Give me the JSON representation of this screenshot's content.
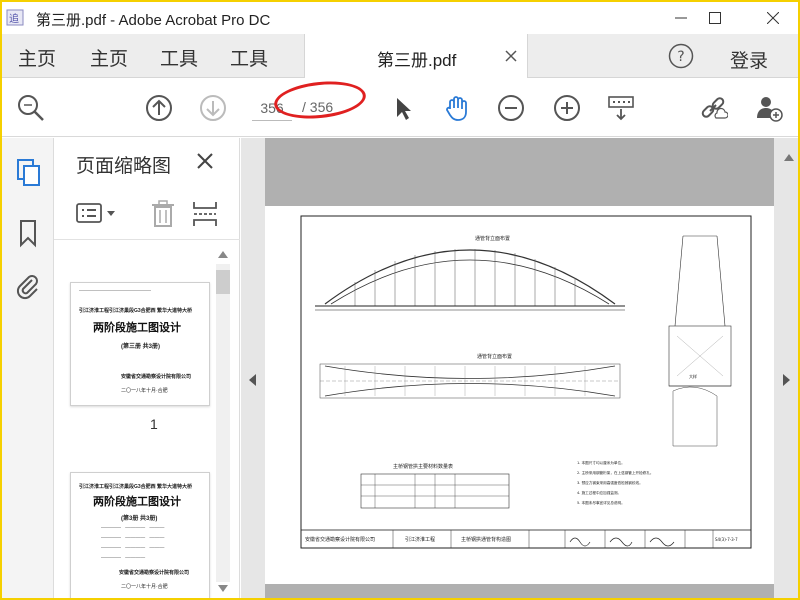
{
  "window": {
    "title": "第三册.pdf - Adobe Acrobat Pro DC"
  },
  "tabs": {
    "nav": [
      "主页",
      "主页",
      "工具",
      "工具"
    ],
    "document_tab": "第三册.pdf",
    "login_label": "登录"
  },
  "toolbar": {
    "current_page": "356",
    "total_pages": "/ 356"
  },
  "thumbnails_panel": {
    "title": "页面缩略图",
    "pages": [
      {
        "number": "1",
        "project": "引江济淮工程引江济巢段G3合肥西 繁华大道特大桥",
        "design_title": "两阶段施工图设计",
        "volume": "(第三册 共3册)",
        "company": "安徽省交通勘察设计院有限公司",
        "date": "二〇一八年十月·合肥"
      },
      {
        "project": "引江济淮工程引江济巢段G3合肥西 繁华大道特大桥",
        "design_title": "两阶段施工图设计",
        "volume": "(第3册 共3册)",
        "company": "安徽省交通勘察设计院有限公司",
        "date": "二〇一八年十月·合肥"
      }
    ]
  },
  "drawing": {
    "elevation_title": "通管背立面布置",
    "plan_title": "通管背立面布置",
    "table_title": "主桥钢管拱主要材料数量表",
    "company": "安徽省交通勘察设计院有限公司",
    "project": "引江济淮工程",
    "sheet": "主桥钢拱通管背构造图",
    "scale_label": "大样",
    "notes": [
      "1. 本图尺寸均以厘米为单位。",
      "2. 主桥采用钢管桁架，在上弦钢管上开检修孔。",
      "3. 预应力钢束采用高强度低松弛钢绞线。",
      "4. 施工过程中应加强监测。",
      "5. 本图未尽事宜详见总说明。"
    ],
    "sheet_no": "S4(3)-7-3-7"
  },
  "colors": {
    "window_border": "#f5d000",
    "annotation": "#e02020",
    "accent_blue": "#2a7ad6"
  }
}
